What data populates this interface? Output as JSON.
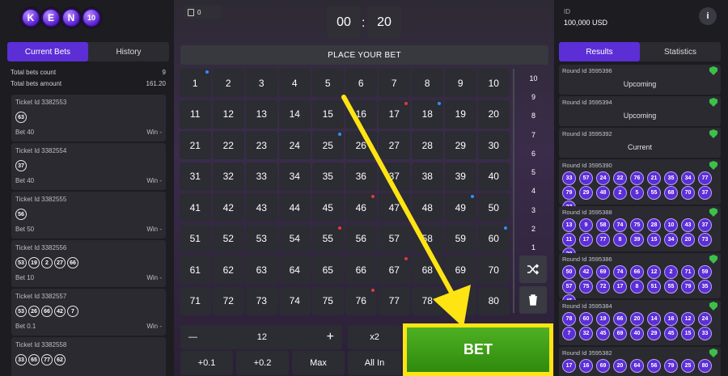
{
  "logo": {
    "letters": [
      "K",
      "E",
      "N",
      "10"
    ]
  },
  "left": {
    "tabs": [
      "Current Bets",
      "History"
    ],
    "total_bets_count_label": "Total bets count",
    "total_bets_count": "9",
    "total_bets_amount_label": "Total bets amount",
    "total_bets_amount": "161.20",
    "tickets": [
      {
        "id": "Ticket Id 3382553",
        "numbers": [
          "63"
        ],
        "bet": "Bet 40",
        "win": "Win -"
      },
      {
        "id": "Ticket Id 3382554",
        "numbers": [
          "37"
        ],
        "bet": "Bet 40",
        "win": "Win -"
      },
      {
        "id": "Ticket Id 3382555",
        "numbers": [
          "56"
        ],
        "bet": "Bet 50",
        "win": "Win -"
      },
      {
        "id": "Ticket Id 3382556",
        "numbers": [
          "53",
          "19",
          "2",
          "27",
          "66"
        ],
        "bet": "Bet 10",
        "win": "Win -"
      },
      {
        "id": "Ticket Id 3382557",
        "numbers": [
          "53",
          "26",
          "66",
          "42",
          "7"
        ],
        "bet": "Bet 0.1",
        "win": "Win -"
      },
      {
        "id": "Ticket Id 3382558",
        "numbers": [
          "33",
          "65",
          "77",
          "62"
        ],
        "bet": "",
        "win": ""
      }
    ]
  },
  "center": {
    "ticket_count": "0",
    "timer": {
      "minutes": "00",
      "seconds": "20",
      "separator": ":"
    },
    "place_bet_label": "PLACE YOUR BET",
    "numbers": [
      "1",
      "2",
      "3",
      "4",
      "5",
      "6",
      "7",
      "8",
      "9",
      "10",
      "11",
      "12",
      "13",
      "14",
      "15",
      "16",
      "17",
      "18",
      "19",
      "20",
      "21",
      "22",
      "23",
      "24",
      "25",
      "26",
      "27",
      "28",
      "29",
      "30",
      "31",
      "32",
      "33",
      "34",
      "35",
      "36",
      "37",
      "38",
      "39",
      "40",
      "41",
      "42",
      "43",
      "44",
      "45",
      "46",
      "47",
      "48",
      "49",
      "50",
      "51",
      "52",
      "53",
      "54",
      "55",
      "56",
      "57",
      "58",
      "59",
      "60",
      "61",
      "62",
      "63",
      "64",
      "65",
      "66",
      "67",
      "68",
      "69",
      "70",
      "71",
      "72",
      "73",
      "74",
      "75",
      "76",
      "77",
      "78",
      "79",
      "80"
    ],
    "blue_dot_numbers": [
      1,
      18,
      25,
      49,
      60
    ],
    "red_dot_numbers": [
      17,
      46,
      55,
      67,
      76
    ],
    "side_counts": [
      "10",
      "9",
      "8",
      "7",
      "6",
      "5",
      "4",
      "3",
      "2",
      "1"
    ],
    "shuffle_icon": "shuffle-icon",
    "trash_icon": "trash-icon",
    "stake": {
      "minus": "—",
      "value": "12",
      "plus": "+",
      "x2": "x2"
    },
    "quick": [
      "+0.1",
      "+0.2",
      "Max",
      "All In"
    ],
    "bet_button": "BET",
    "colors": {
      "accent": "#5b2ed6",
      "bet_green": "#3d9d18",
      "highlight": "#ffe414",
      "dot_blue": "#2f8fff",
      "dot_red": "#e23a3a"
    }
  },
  "right": {
    "id_label": "ID",
    "balance": "100,000 USD",
    "info": "i",
    "tabs": [
      "Results",
      "Statistics"
    ],
    "rounds": [
      {
        "id": "Round Id 3595396",
        "status": "Upcoming",
        "balls": []
      },
      {
        "id": "Round Id 3595394",
        "status": "Upcoming",
        "balls": []
      },
      {
        "id": "Round Id 3595392",
        "status": "Current",
        "balls": []
      },
      {
        "id": "Round Id 3595390",
        "status": "",
        "balls": [
          "33",
          "57",
          "24",
          "22",
          "76",
          "21",
          "35",
          "34",
          "77",
          "79",
          "29",
          "48",
          "2",
          "5",
          "55",
          "68",
          "70",
          "37",
          "27"
        ]
      },
      {
        "id": "Round Id 3595388",
        "status": "",
        "balls": [
          "13",
          "9",
          "58",
          "74",
          "75",
          "28",
          "10",
          "43",
          "37",
          "11",
          "17",
          "77",
          "8",
          "39",
          "15",
          "34",
          "20",
          "73",
          "38"
        ]
      },
      {
        "id": "Round Id 3595386",
        "status": "",
        "balls": [
          "50",
          "42",
          "69",
          "74",
          "66",
          "12",
          "2",
          "71",
          "59",
          "57",
          "75",
          "72",
          "17",
          "8",
          "51",
          "55",
          "79",
          "35",
          "45"
        ]
      },
      {
        "id": "Round Id 3595384",
        "status": "",
        "balls": [
          "78",
          "60",
          "19",
          "66",
          "20",
          "14",
          "16",
          "12",
          "24",
          "7",
          "32",
          "45",
          "69",
          "40",
          "29",
          "45",
          "15",
          "33"
        ]
      },
      {
        "id": "Round Id 3595382",
        "status": "",
        "balls": [
          "17",
          "16",
          "69",
          "20",
          "64",
          "56",
          "79",
          "25",
          "80"
        ]
      }
    ]
  }
}
